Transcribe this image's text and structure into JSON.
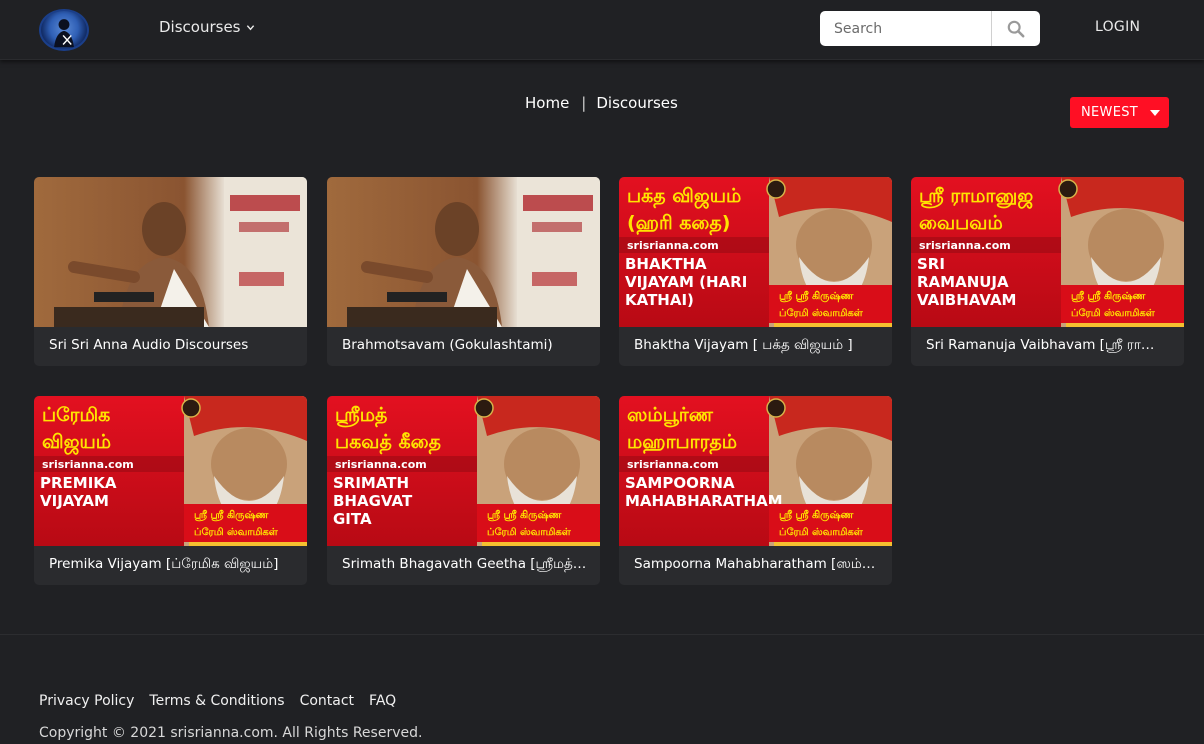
{
  "header": {
    "nav_discourses": "Discourses",
    "search_placeholder": "Search",
    "login": "LOGIN"
  },
  "breadcrumb": {
    "home": "Home",
    "separator": "|",
    "current": "Discourses"
  },
  "sort": {
    "selected": "NEWEST"
  },
  "colors": {
    "background": "#202124",
    "card": "#2a2b2e",
    "accent_red": "#ff0f24",
    "thumb_red": "#d90d18",
    "thumb_yellow": "#ffe400"
  },
  "cards": [
    {
      "title": "Sri Sri Anna Audio Discourses",
      "thumb": "photo"
    },
    {
      "title": "Brahmotsavam (Gokulashtami)",
      "thumb": "photo"
    },
    {
      "title": "Bhaktha Vijayam [ பக்த விஜயம் ]",
      "thumb": "text",
      "tamil": [
        "பக்த விஜயம்",
        "(ஹரி கதை)"
      ],
      "site": "srisrianna.com",
      "english": [
        "BHAKTHA",
        "VIJAYAM (HARI",
        "KATHAI)"
      ],
      "caption": [
        "ஸ்ரீ ஸ்ரீ கிருஷ்ண",
        "ப்ரேமி ஸ்வாமிகள்"
      ]
    },
    {
      "title": "Sri Ramanuja Vaibhavam [ஸ்ரீ ராமானுஜ வைபவம்]",
      "thumb": "text",
      "tamil": [
        "ஸ்ரீ ராமானுஜ",
        "வைபவம்"
      ],
      "site": "srisrianna.com",
      "english": [
        "SRI",
        "RAMANUJA",
        "VAIBHAVAM"
      ],
      "caption": [
        "ஸ்ரீ ஸ்ரீ கிருஷ்ண",
        "ப்ரேமி ஸ்வாமிகள்"
      ]
    },
    {
      "title": "Premika Vijayam [ப்ரேமிக விஜயம்]",
      "thumb": "text",
      "tamil": [
        "ப்ரேமிக",
        "விஜயம்"
      ],
      "site": "srisrianna.com",
      "english": [
        "PREMIKA",
        "VIJAYAM"
      ],
      "caption": [
        "ஸ்ரீ ஸ்ரீ கிருஷ்ண",
        "ப்ரேமி ஸ்வாமிகள்"
      ]
    },
    {
      "title": "Srimath Bhagavath Geetha [ஸ்ரீமத் பகவத் கீதை]",
      "thumb": "text",
      "tamil": [
        "ஸ்ரீமத்",
        "பகவத் கீதை"
      ],
      "site": "srisrianna.com",
      "english": [
        "SRIMATH",
        "BHAGVAT",
        "GITA"
      ],
      "caption": [
        "ஸ்ரீ ஸ்ரீ கிருஷ்ண",
        "ப்ரேமி ஸ்வாமிகள்"
      ]
    },
    {
      "title": "Sampoorna Mahabharatham [ஸம்பூர்ண மஹாபாரதம்]",
      "thumb": "text",
      "tamil": [
        "ஸம்பூர்ண",
        "மஹாபாரதம்"
      ],
      "site": "srisrianna.com",
      "english": [
        "SAMPOORNA",
        "MAHABHARATHAM"
      ],
      "caption": [
        "ஸ்ரீ ஸ்ரீ கிருஷ்ண",
        "ப்ரேமி ஸ்வாமிகள்"
      ]
    }
  ],
  "footer": {
    "links": [
      "Privacy Policy",
      "Terms & Conditions",
      "Contact",
      "FAQ"
    ],
    "copyright": "Copyright © 2021 srisrianna.com. All Rights Reserved."
  }
}
